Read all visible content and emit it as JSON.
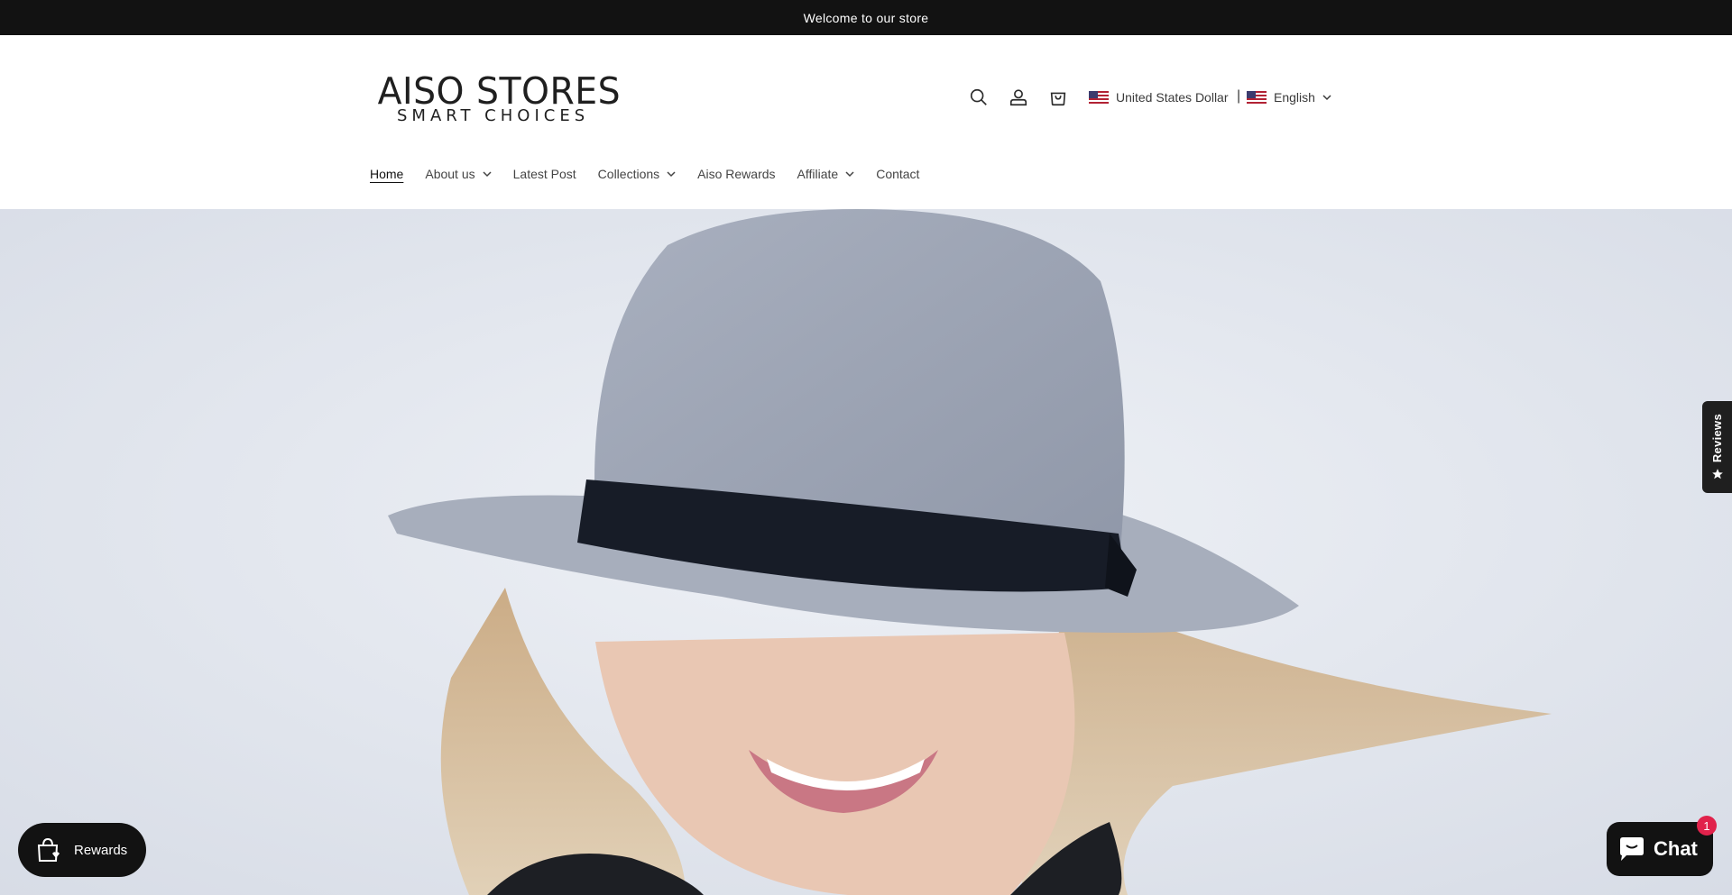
{
  "announcement": {
    "text": "Welcome to our store"
  },
  "logo": {
    "main": "AISO STORES",
    "tagline": "SMART CHOICES"
  },
  "header_icons": [
    "search-icon",
    "account-icon",
    "cart-icon"
  ],
  "currency": {
    "label": "United States Dollar",
    "flag": "us-flag-icon"
  },
  "language": {
    "label": "English",
    "flag": "us-flag-icon"
  },
  "nav": {
    "items": [
      {
        "label": "Home",
        "active": true,
        "dropdown": false
      },
      {
        "label": "About us",
        "active": false,
        "dropdown": true
      },
      {
        "label": "Latest Post",
        "active": false,
        "dropdown": false
      },
      {
        "label": "Collections",
        "active": false,
        "dropdown": true
      },
      {
        "label": "Aiso Rewards",
        "active": false,
        "dropdown": false
      },
      {
        "label": "Affiliate",
        "active": false,
        "dropdown": true
      },
      {
        "label": "Contact",
        "active": false,
        "dropdown": false
      }
    ]
  },
  "reviews_tab": {
    "label": "Reviews",
    "icon": "star-icon"
  },
  "rewards_button": {
    "label": "Rewards",
    "icon": "shopping-bag-heart-icon"
  },
  "chat_button": {
    "label": "Chat",
    "badge": "1",
    "icon": "chat-bubble-icon"
  },
  "colors": {
    "dark": "#121212",
    "badge": "#e1224b",
    "text": "#3a3a3a"
  }
}
